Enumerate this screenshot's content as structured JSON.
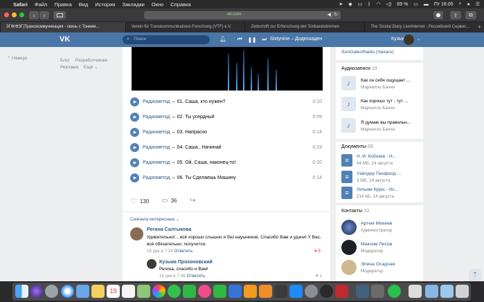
{
  "menubar": {
    "apple": "",
    "app_name": "Safari",
    "items": [
      "Файл",
      "Правка",
      "Вид",
      "История",
      "Закладки",
      "Окно",
      "Справка"
    ],
    "battery": "69 %",
    "clock": "Пт 16:05"
  },
  "toolbar": {
    "back": "‹",
    "forward": "›",
    "url": "vk.com"
  },
  "tabs": [
    "ЗГФ/ФЗГ|Транскоммуникация - связь с Тонким...",
    "Verein für Transkommunikations-Forschung (VTF) e.V.",
    "Zeitschrift zur Erforschung der Tonbandstimmen",
    "The Sicidal Diary LiveInternet - Российский Сервис..."
  ],
  "vk": {
    "logo": "VK",
    "search_placeholder": "Поиск",
    "player_title": "Sixtynine – Додескаден",
    "user_name": "Кузьма"
  },
  "left_nav": {
    "up_label": "Наверх",
    "links": [
      "Блог",
      "Разработчикам",
      "Реклама",
      "Ещё ⌄"
    ]
  },
  "tracks": [
    {
      "artist": "Радиометод",
      "title": "01. Саша, кто нужен?",
      "duration": "0:10"
    },
    {
      "artist": "Радиометод",
      "title": "02. Ты усердный",
      "duration": "0:09"
    },
    {
      "artist": "Радиометод",
      "title": "03. Напрасно",
      "duration": "0:14"
    },
    {
      "artist": "Радиометод",
      "title": "04. Саша...Начинай",
      "duration": "0:23"
    },
    {
      "artist": "Радиометод",
      "title": "05. Ой, Саша, наконец-то!",
      "duration": "0:20"
    },
    {
      "artist": "Радиометод",
      "title": "06. Ты Сделаешь Машину",
      "duration": "0:14"
    }
  ],
  "post_actions": {
    "likes": "130",
    "comments": "36"
  },
  "comments_sort": "Сначала интересные ⌄",
  "comments": [
    {
      "author": "Регина Салтыкова",
      "text": "Удивительно!... всё хорошо слышно и без наушников. Спасибо Вам и удачи! У Вас, всё обязательно, получится.",
      "date": "16 дек в 7:34",
      "reply": "Ответить",
      "likes": "6"
    },
    {
      "author": "Кузьма Прохоновский",
      "text": "Регина, спасибо и Вам!",
      "date": "16 дек в 7:36",
      "reply": "Ответить",
      "likes": "1"
    }
  ],
  "sidebar": {
    "group_link": "SunGatesRadio (Чикаго)",
    "audio_header": "Аудиозаписи",
    "audio_count": "19",
    "audios": [
      {
        "title": "Как он себя ощущает ...",
        "artist": "Марчелло Баччи"
      },
      {
        "title": "Как хорошо тут - тут ...",
        "artist": "Марчелло Баччи"
      },
      {
        "title": "Я думаю вы правильн...",
        "artist": "Марчелло Баччи"
      }
    ],
    "docs_header": "Документы",
    "docs_count": "68",
    "docs": [
      {
        "title": "Н. И. Кобозев - И...",
        "meta": "64 МБ, 14 августа"
      },
      {
        "title": "Уайлдер Пенфилд -...",
        "meta": "3 МБ, 14 августа"
      },
      {
        "title": "Уильям Крукс - Ис...",
        "meta": "214 КБ, 14 августа"
      }
    ],
    "contacts_header": "Контакты",
    "contacts_count": "10",
    "contacts": [
      {
        "name": "Артем Михеев",
        "role": "Администратор"
      },
      {
        "name": "Максим Лисов",
        "role": "Модератор"
      },
      {
        "name": "Элина Осадчая",
        "role": "Модератор"
      }
    ]
  },
  "colors": {
    "vk_blue": "#4a76a8",
    "link": "#2a5885",
    "play_button": "#5181b8",
    "page_bg": "#edeef0"
  }
}
